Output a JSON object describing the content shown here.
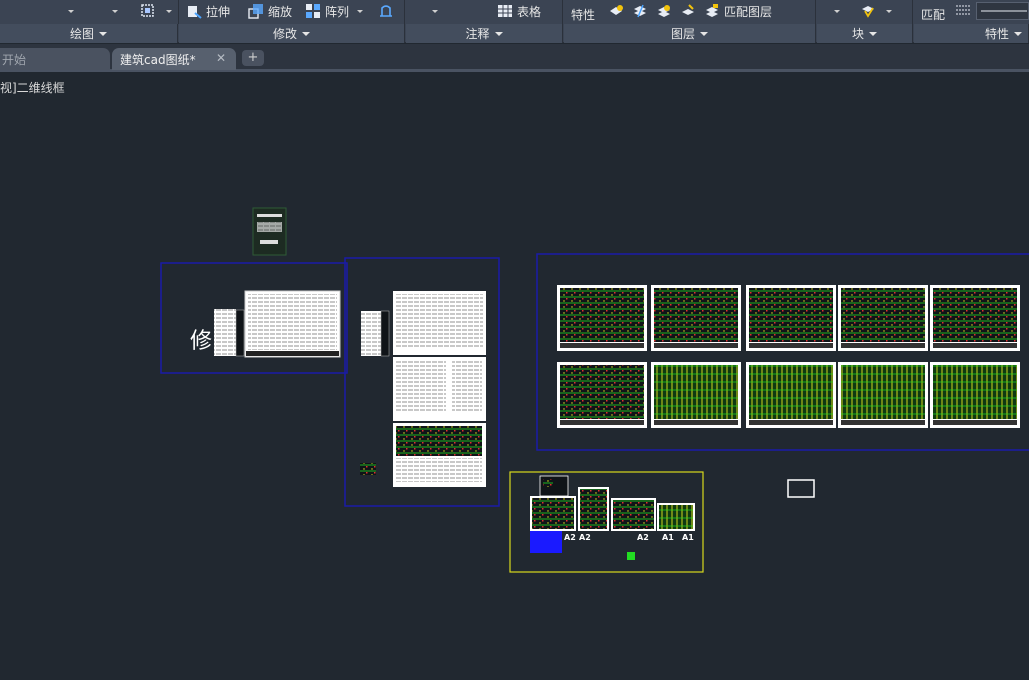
{
  "ribbon": {
    "tools": {
      "stretch": "拉伸",
      "scale": "缩放",
      "array": "阵列",
      "table": "表格",
      "properties": "特性",
      "match_layer": "匹配图层",
      "match": "匹配"
    },
    "panels": {
      "draw": "绘图",
      "modify": "修改",
      "annotation": "注释",
      "layers": "图层",
      "block": "块",
      "properties": "特性"
    }
  },
  "tabs": {
    "start": "开始",
    "drawing": "建筑cad图纸*",
    "close_glyph": "✕",
    "add_glyph": "+"
  },
  "viewport": {
    "label": "视]二维线框"
  },
  "drawing": {
    "handwritten_char": "修",
    "sheet_labels": [
      "A2",
      "A2",
      "A2",
      "A1",
      "A1"
    ]
  },
  "colors": {
    "ribbon_bg": "#3b4453",
    "canvas_bg": "#212830",
    "frame_blue": "#1a1aa8",
    "frame_yellow": "#d8d81c",
    "cad_green": "#22dd22",
    "cad_yellow": "#e8e820"
  },
  "icons": [
    "stretch-icon",
    "scale-icon",
    "array-icon",
    "table-icon",
    "properties-icon",
    "layer-icon",
    "match-layer-icon",
    "close-icon",
    "add-icon"
  ]
}
